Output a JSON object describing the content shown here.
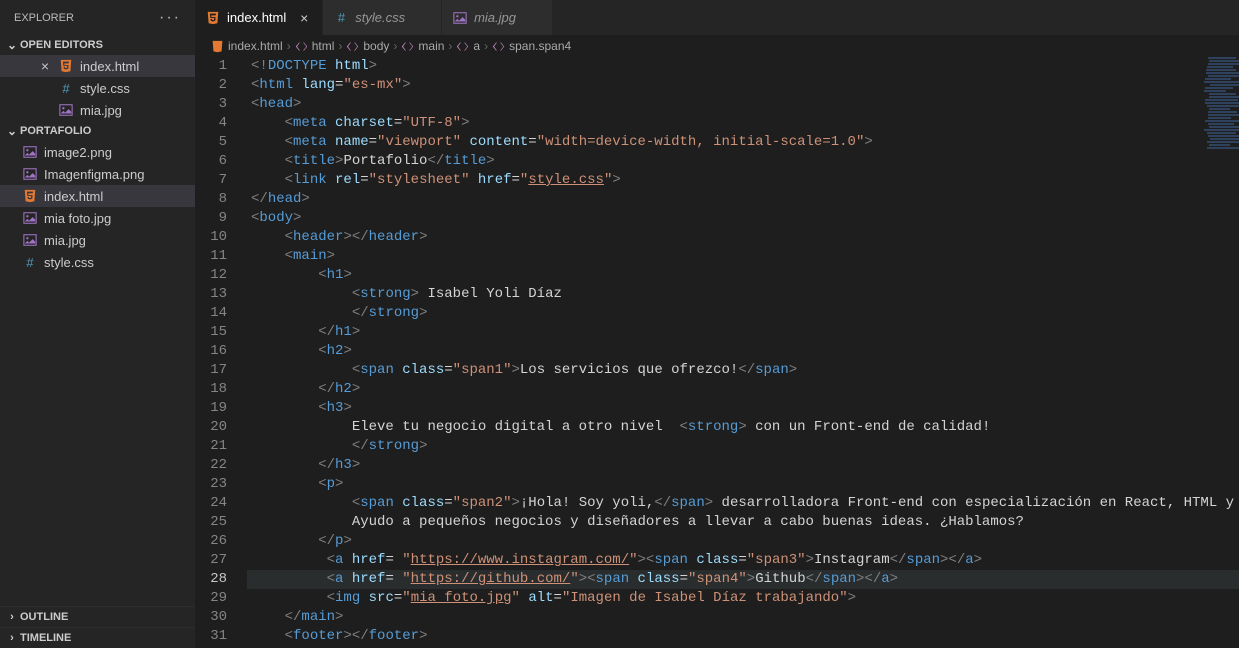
{
  "sidebar": {
    "title": "EXPLORER",
    "sections": {
      "openEditors": {
        "label": "OPEN EDITORS",
        "items": [
          {
            "name": "index.html",
            "icon": "html",
            "active": true,
            "close": true
          },
          {
            "name": "style.css",
            "icon": "css",
            "active": false,
            "close": false
          },
          {
            "name": "mia.jpg",
            "icon": "img",
            "active": false,
            "close": false
          }
        ]
      },
      "folder": {
        "label": "PORTAFOLIO",
        "items": [
          {
            "name": "image2.png",
            "icon": "img"
          },
          {
            "name": "Imagenfigma.png",
            "icon": "img"
          },
          {
            "name": "index.html",
            "icon": "html",
            "active": true
          },
          {
            "name": "mia foto.jpg",
            "icon": "img"
          },
          {
            "name": "mia.jpg",
            "icon": "img"
          },
          {
            "name": "style.css",
            "icon": "css"
          }
        ]
      }
    },
    "collapsed": [
      {
        "label": "OUTLINE"
      },
      {
        "label": "TIMELINE"
      }
    ]
  },
  "tabs": [
    {
      "name": "index.html",
      "icon": "html",
      "active": true
    },
    {
      "name": "style.css",
      "icon": "css",
      "active": false
    },
    {
      "name": "mia.jpg",
      "icon": "img",
      "active": false
    }
  ],
  "breadcrumbs": [
    {
      "label": "index.html",
      "icon": "file"
    },
    {
      "label": "html",
      "icon": "tag"
    },
    {
      "label": "body",
      "icon": "tag"
    },
    {
      "label": "main",
      "icon": "tag"
    },
    {
      "label": "a",
      "icon": "tag"
    },
    {
      "label": "span.span4",
      "icon": "tag"
    }
  ],
  "editor": {
    "currentLine": 28,
    "lines": [
      {
        "n": 1,
        "html": "<span class='t-brk'>&lt;!</span><span class='t-tag'>DOCTYPE</span> <span class='t-attr'>html</span><span class='t-brk'>&gt;</span>"
      },
      {
        "n": 2,
        "html": "<span class='t-brk'>&lt;</span><span class='t-tag'>html</span> <span class='t-attr'>lang</span>=<span class='t-str'>\"es-mx\"</span><span class='t-brk'>&gt;</span>"
      },
      {
        "n": 3,
        "html": "<span class='t-brk'>&lt;</span><span class='t-tag'>head</span><span class='t-brk'>&gt;</span>"
      },
      {
        "n": 4,
        "html": "<span class='guide'>    </span><span class='t-brk'>&lt;</span><span class='t-tag'>meta</span> <span class='t-attr'>charset</span>=<span class='t-str'>\"UTF-8\"</span><span class='t-brk'>&gt;</span>"
      },
      {
        "n": 5,
        "html": "<span class='guide'>    </span><span class='t-brk'>&lt;</span><span class='t-tag'>meta</span> <span class='t-attr'>name</span>=<span class='t-str'>\"viewport\"</span> <span class='t-attr'>content</span>=<span class='t-str'>\"width=device-width, initial-scale=1.0\"</span><span class='t-brk'>&gt;</span>"
      },
      {
        "n": 6,
        "html": "<span class='guide'>    </span><span class='t-brk'>&lt;</span><span class='t-tag'>title</span><span class='t-brk'>&gt;</span><span class='t-txt'>Portafolio</span><span class='t-brk'>&lt;/</span><span class='t-tag'>title</span><span class='t-brk'>&gt;</span>"
      },
      {
        "n": 7,
        "html": "<span class='guide'>    </span><span class='t-brk'>&lt;</span><span class='t-tag'>link</span> <span class='t-attr'>rel</span>=<span class='t-str'>\"stylesheet\"</span> <span class='t-attr'>href</span>=<span class='t-str'>\"</span><span class='t-link'>style.css</span><span class='t-str'>\"</span><span class='t-brk'>&gt;</span>"
      },
      {
        "n": 8,
        "html": "<span class='t-brk'>&lt;/</span><span class='t-tag'>head</span><span class='t-brk'>&gt;</span>"
      },
      {
        "n": 9,
        "html": "<span class='t-brk'>&lt;</span><span class='t-tag'>body</span><span class='t-brk'>&gt;</span>"
      },
      {
        "n": 10,
        "html": "<span class='guide'>    </span><span class='t-brk'>&lt;</span><span class='t-tag'>header</span><span class='t-brk'>&gt;&lt;/</span><span class='t-tag'>header</span><span class='t-brk'>&gt;</span>"
      },
      {
        "n": 11,
        "html": "<span class='guide'>    </span><span class='t-brk'>&lt;</span><span class='t-tag'>main</span><span class='t-brk'>&gt;</span>"
      },
      {
        "n": 12,
        "html": "<span class='guide'>        </span><span class='t-brk'>&lt;</span><span class='t-tag'>h1</span><span class='t-brk'>&gt;</span>"
      },
      {
        "n": 13,
        "html": "<span class='guide'>            </span><span class='t-brk'>&lt;</span><span class='t-tag'>strong</span><span class='t-brk'>&gt;</span><span class='t-txt'> Isabel Yoli Díaz</span>"
      },
      {
        "n": 14,
        "html": "<span class='guide'>            </span><span class='t-brk'>&lt;/</span><span class='t-tag'>strong</span><span class='t-brk'>&gt;</span>"
      },
      {
        "n": 15,
        "html": "<span class='guide'>        </span><span class='t-brk'>&lt;/</span><span class='t-tag'>h1</span><span class='t-brk'>&gt;</span>"
      },
      {
        "n": 16,
        "html": "<span class='guide'>        </span><span class='t-brk'>&lt;</span><span class='t-tag'>h2</span><span class='t-brk'>&gt;</span>"
      },
      {
        "n": 17,
        "html": "<span class='guide'>            </span><span class='t-brk'>&lt;</span><span class='t-tag'>span</span> <span class='t-attr'>class</span>=<span class='t-str'>\"span1\"</span><span class='t-brk'>&gt;</span><span class='t-txt'>Los servicios que ofrezco!</span><span class='t-brk'>&lt;/</span><span class='t-tag'>span</span><span class='t-brk'>&gt;</span>"
      },
      {
        "n": 18,
        "html": "<span class='guide'>        </span><span class='t-brk'>&lt;/</span><span class='t-tag'>h2</span><span class='t-brk'>&gt;</span>"
      },
      {
        "n": 19,
        "html": "<span class='guide'>        </span><span class='t-brk'>&lt;</span><span class='t-tag'>h3</span><span class='t-brk'>&gt;</span>"
      },
      {
        "n": 20,
        "html": "<span class='guide'>            </span><span class='t-txt'>Eleve tu negocio digital a otro nivel  </span><span class='t-brk'>&lt;</span><span class='t-tag'>strong</span><span class='t-brk'>&gt;</span><span class='t-txt'> con un Front-end de calidad!</span>"
      },
      {
        "n": 21,
        "html": "<span class='guide'>            </span><span class='t-brk'>&lt;/</span><span class='t-tag'>strong</span><span class='t-brk'>&gt;</span>"
      },
      {
        "n": 22,
        "html": "<span class='guide'>        </span><span class='t-brk'>&lt;/</span><span class='t-tag'>h3</span><span class='t-brk'>&gt;</span>"
      },
      {
        "n": 23,
        "html": "<span class='guide'>        </span><span class='t-brk'>&lt;</span><span class='t-tag'>p</span><span class='t-brk'>&gt;</span>"
      },
      {
        "n": 24,
        "html": "<span class='guide'>            </span><span class='t-brk'>&lt;</span><span class='t-tag'>span</span> <span class='t-attr'>class</span>=<span class='t-str'>\"span2\"</span><span class='t-brk'>&gt;</span><span class='t-txt'>¡Hola! Soy yoli,</span><span class='t-brk'>&lt;/</span><span class='t-tag'>span</span><span class='t-brk'>&gt;</span><span class='t-txt'> desarrolladora Front-end con especialización en React, HTML y CSS</span>"
      },
      {
        "n": 25,
        "html": "<span class='guide'>            </span><span class='t-txt'>Ayudo a pequeños negocios y diseñadores a llevar a cabo buenas ideas. ¿Hablamos?</span>"
      },
      {
        "n": 26,
        "html": "<span class='guide'>        </span><span class='t-brk'>&lt;/</span><span class='t-tag'>p</span><span class='t-brk'>&gt;</span>"
      },
      {
        "n": 27,
        "html": "<span class='guide'>         </span><span class='t-brk'>&lt;</span><span class='t-tag'>a</span> <span class='t-attr'>href</span>= <span class='t-str'>\"</span><span class='t-link'>https://www.instagram.com/</span><span class='t-str'>\"</span><span class='t-brk'>&gt;&lt;</span><span class='t-tag'>span</span> <span class='t-attr'>class</span>=<span class='t-str'>\"span3\"</span><span class='t-brk'>&gt;</span><span class='t-txt'>Instagram</span><span class='t-brk'>&lt;/</span><span class='t-tag'>span</span><span class='t-brk'>&gt;&lt;/</span><span class='t-tag'>a</span><span class='t-brk'>&gt;</span>"
      },
      {
        "n": 28,
        "html": "<span class='guide'>         </span><span class='t-brk'>&lt;</span><span class='t-tag'>a</span> <span class='t-attr'>href</span>= <span class='t-str'>\"</span><span class='t-link'>https://github.com/</span><span class='t-str'>\"</span><span class='t-brk'>&gt;&lt;</span><span class='t-tag'>span</span> <span class='t-attr'>class</span>=<span class='t-str'>\"span4\"</span><span class='t-brk'>&gt;</span><span class='t-txt'>Github</span><span class='t-brk'>&lt;/</span><span class='t-tag'>span</span><span class='t-brk'>&gt;&lt;/</span><span class='t-tag'>a</span><span class='t-brk'>&gt;</span>"
      },
      {
        "n": 29,
        "html": "<span class='guide'>         </span><span class='t-brk'>&lt;</span><span class='t-tag'>img</span> <span class='t-attr'>src</span>=<span class='t-str'>\"</span><span class='t-link'>mia foto.jpg</span><span class='t-str'>\"</span> <span class='t-attr'>alt</span>=<span class='t-str'>\"Imagen de Isabel Díaz trabajando\"</span><span class='t-brk'>&gt;</span>"
      },
      {
        "n": 30,
        "html": "<span class='guide'>    </span><span class='t-brk'>&lt;/</span><span class='t-tag'>main</span><span class='t-brk'>&gt;</span>"
      },
      {
        "n": 31,
        "html": "<span class='guide'>    </span><span class='t-brk'>&lt;</span><span class='t-tag'>footer</span><span class='t-brk'>&gt;&lt;/</span><span class='t-tag'>footer</span><span class='t-brk'>&gt;</span>"
      }
    ]
  }
}
